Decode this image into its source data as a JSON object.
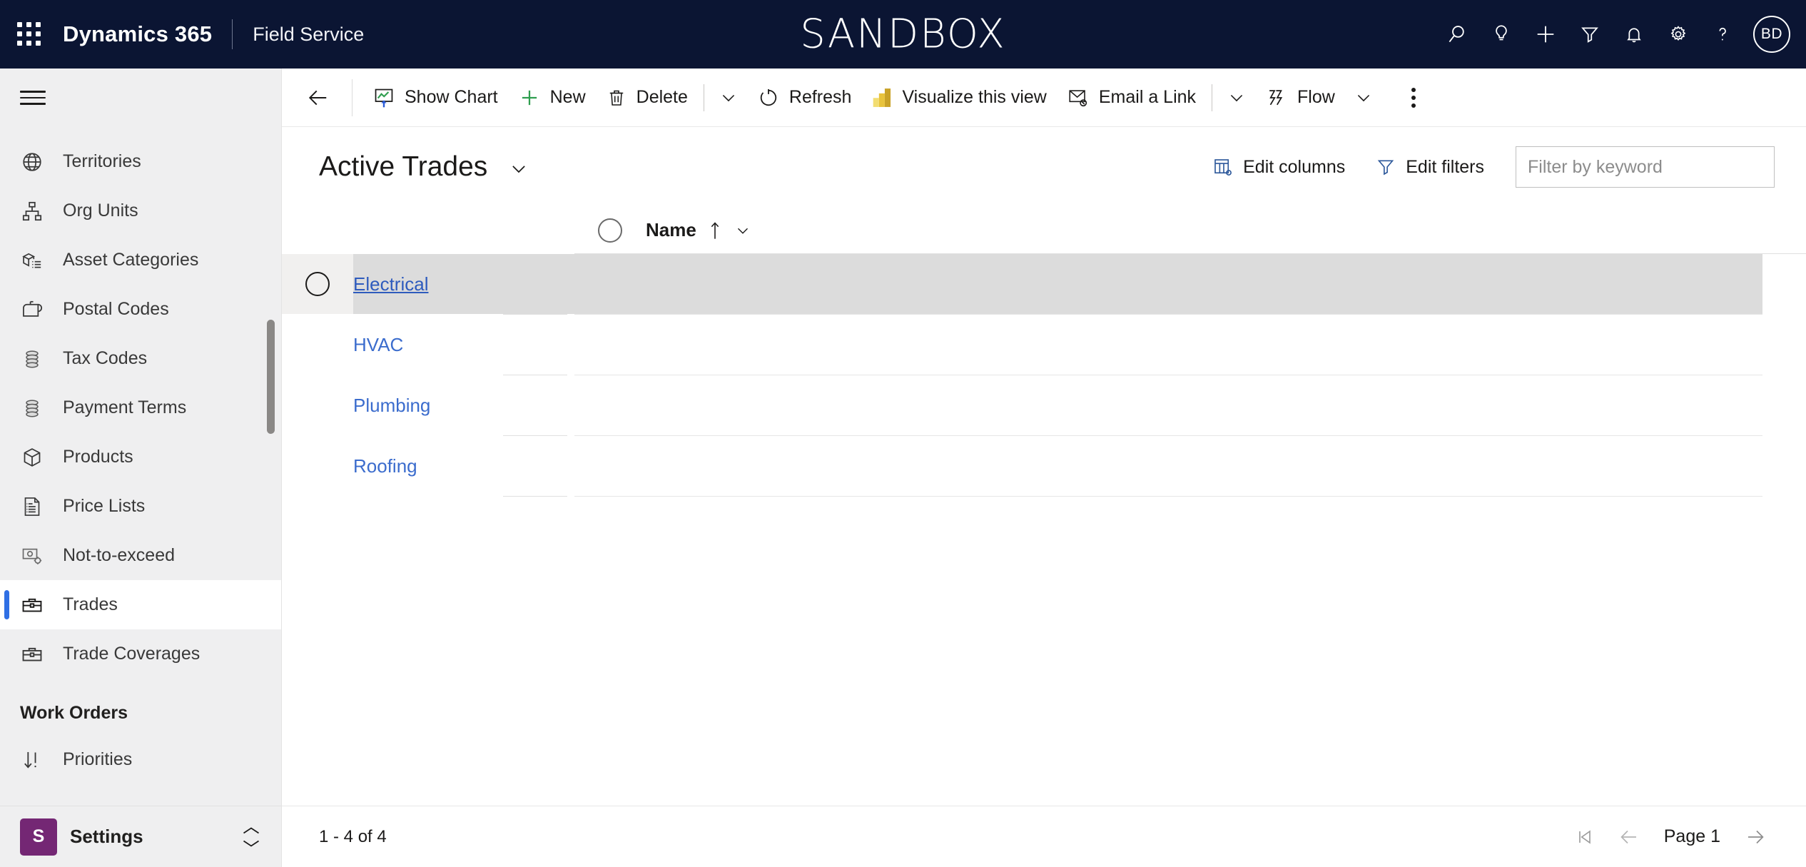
{
  "header": {
    "waffle_icon": "waffle-icon",
    "brand": "Dynamics 365",
    "app_name": "Field Service",
    "environment_banner": "SANDBOX",
    "banner_color": "#ffffff",
    "background_color": "#0b1533",
    "actions": [
      {
        "name": "search-icon",
        "label": "Search"
      },
      {
        "name": "lightbulb-icon",
        "label": "Tips"
      },
      {
        "name": "plus-icon",
        "label": "Quick create"
      },
      {
        "name": "filter-icon",
        "label": "Filter"
      },
      {
        "name": "bell-icon",
        "label": "Notifications"
      },
      {
        "name": "gear-icon",
        "label": "Settings"
      },
      {
        "name": "question-icon",
        "label": "Help"
      }
    ],
    "avatar": {
      "initials": "BD"
    }
  },
  "sidebar": {
    "hamburger_label": "Site map",
    "items": [
      {
        "label": "Territories",
        "icon": "globe-icon",
        "selected": false
      },
      {
        "label": "Org Units",
        "icon": "org-chart-icon",
        "selected": false
      },
      {
        "label": "Asset Categories",
        "icon": "asset-category-icon",
        "selected": false
      },
      {
        "label": "Postal Codes",
        "icon": "mailbox-icon",
        "selected": false
      },
      {
        "label": "Tax Codes",
        "icon": "stack-disc-icon",
        "selected": false
      },
      {
        "label": "Payment Terms",
        "icon": "stack-disc-icon",
        "selected": false
      },
      {
        "label": "Products",
        "icon": "box-icon",
        "selected": false
      },
      {
        "label": "Price Lists",
        "icon": "document-list-icon",
        "selected": false
      },
      {
        "label": "Not-to-exceed",
        "icon": "not-to-exceed-icon",
        "selected": false
      },
      {
        "label": "Trades",
        "icon": "toolbox-icon",
        "selected": true
      },
      {
        "label": "Trade Coverages",
        "icon": "toolbox-icon",
        "selected": false
      }
    ],
    "group_label": "Work Orders",
    "group_items": [
      {
        "label": "Priorities",
        "icon": "sort-priority-icon",
        "selected": false
      }
    ],
    "area_switcher": {
      "badge": "S",
      "label": "Settings",
      "badge_color": "#742774"
    },
    "selection_accent": "#2f6fe4"
  },
  "commandbar": {
    "back_label": "Back",
    "items": [
      {
        "label": "Show Chart",
        "icon": "show-chart-icon"
      },
      {
        "label": "New",
        "icon": "plus-icon"
      },
      {
        "label": "Delete",
        "icon": "trash-icon"
      },
      {
        "label": "Refresh",
        "icon": "refresh-icon"
      },
      {
        "label": "Visualize this view",
        "icon": "power-bi-icon"
      },
      {
        "label": "Email a Link",
        "icon": "email-link-icon"
      },
      {
        "label": "Flow",
        "icon": "flow-icon"
      }
    ],
    "more_label": "More commands"
  },
  "view": {
    "title": "Active Trades",
    "edit_columns_label": "Edit columns",
    "edit_filters_label": "Edit filters",
    "search": {
      "placeholder": "Filter by keyword",
      "value": ""
    }
  },
  "grid": {
    "columns": [
      {
        "label": "Name",
        "sort": "ascending"
      }
    ],
    "select_all_label": "Select all rows",
    "rows": [
      {
        "name": "Electrical",
        "hovered": true
      },
      {
        "name": "HVAC",
        "hovered": false
      },
      {
        "name": "Plumbing",
        "hovered": false
      },
      {
        "name": "Roofing",
        "hovered": false
      }
    ],
    "link_color": "#3b6ccd"
  },
  "footer": {
    "record_count": "1 - 4 of 4",
    "page_label": "Page 1",
    "first_page_label": "First page",
    "previous_page_label": "Previous page",
    "next_page_label": "Next page"
  }
}
